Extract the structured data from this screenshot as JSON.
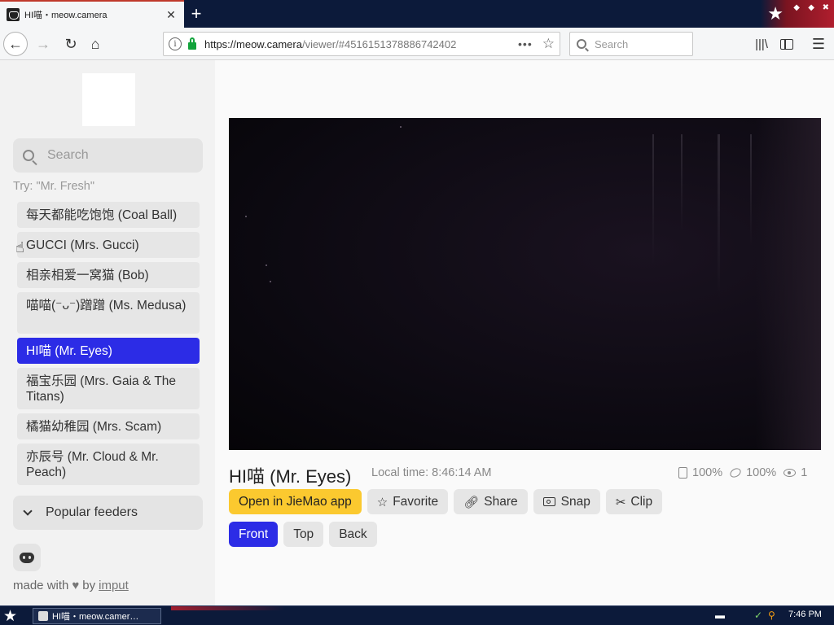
{
  "browser": {
    "tab_title": "HI喵・meow.camera",
    "tab_close": "✕",
    "new_tab": "+",
    "url_host": "https://meow.camera",
    "url_path": "/viewer/#4516151378886742402",
    "url_menu": "•••",
    "search_placeholder": "Search"
  },
  "sidebar": {
    "search_placeholder": "Search",
    "try_hint": "Try: \"Mr. Fresh\"",
    "cameras": [
      {
        "label": "每天都能吃饱饱 (Coal Ball)"
      },
      {
        "label": "GUCCI (Mrs. Gucci)"
      },
      {
        "label": "相亲相爱一窝猫 (Bob)"
      },
      {
        "label": "喵喵(⁻ᴗ⁻)蹭蹭 (Ms. Medusa)"
      },
      {
        "label": "HI喵 (Mr. Eyes)"
      },
      {
        "label": "福宝乐园 (Mrs. Gaia & The Titans)"
      },
      {
        "label": "橘猫幼稚园 (Mrs. Scam)"
      },
      {
        "label": "亦辰号 (Mr. Cloud & Mr. Peach)"
      }
    ],
    "popular_feeders": "Popular feeders",
    "made_with": "made with",
    "by": "by",
    "author": "imput"
  },
  "viewer": {
    "title": "HI喵 (Mr. Eyes)",
    "local_time": "Local time: 8:46:14 AM",
    "food_level": "100%",
    "treat_level": "100%",
    "viewers": "1",
    "buttons": {
      "open_app": "Open in JieMao app",
      "favorite": "Favorite",
      "share": "Share",
      "snap": "Snap",
      "clip": "Clip"
    },
    "views": {
      "front": "Front",
      "top": "Top",
      "back": "Back"
    }
  },
  "taskbar": {
    "task_title": "HI喵・meow.camer…",
    "clock": "7:46 PM"
  },
  "colors": {
    "accent": "#2c2ce6",
    "app_button": "#fbc92f"
  }
}
